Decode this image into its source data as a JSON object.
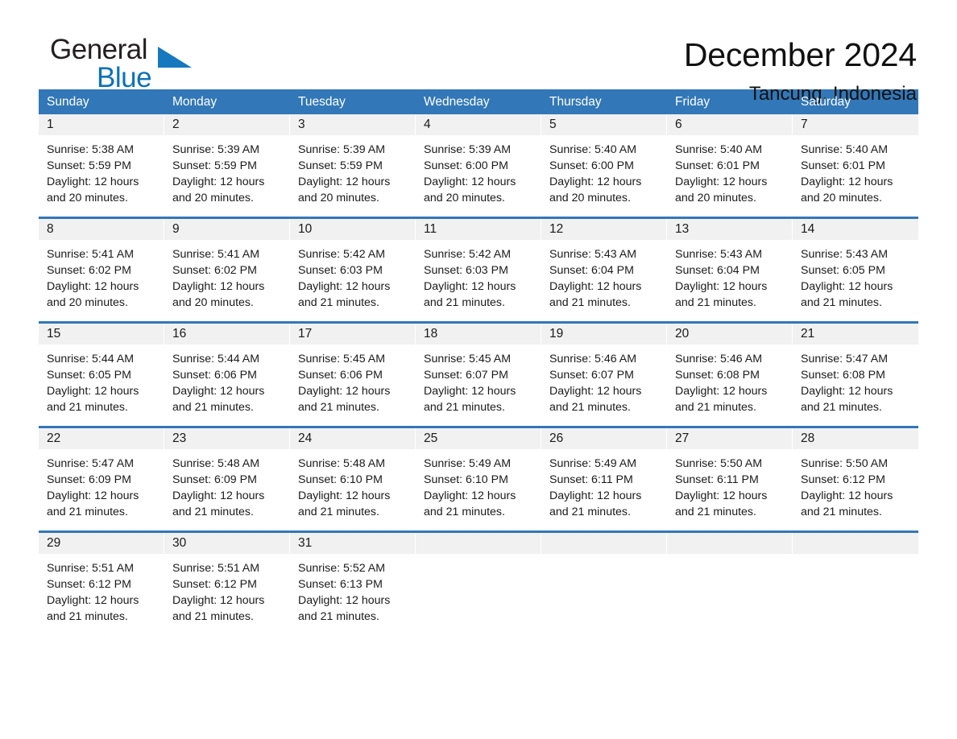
{
  "brand": {
    "name_part1": "General",
    "name_part2": "Blue",
    "triangle_color": "#1678be",
    "blue_color": "#0b72b9"
  },
  "header": {
    "title": "December 2024",
    "location": "Tancung, Indonesia"
  },
  "colors": {
    "header_blue": "#3277b7",
    "day_band": "#f1f1f1",
    "text": "#1a1a1a"
  },
  "calendar": {
    "weekday_headers": [
      "Sunday",
      "Monday",
      "Tuesday",
      "Wednesday",
      "Thursday",
      "Friday",
      "Saturday"
    ],
    "weeks": [
      [
        {
          "day": "1",
          "sunrise": "Sunrise: 5:38 AM",
          "sunset": "Sunset: 5:59 PM",
          "daylight_line1": "Daylight: 12 hours",
          "daylight_line2": "and 20 minutes."
        },
        {
          "day": "2",
          "sunrise": "Sunrise: 5:39 AM",
          "sunset": "Sunset: 5:59 PM",
          "daylight_line1": "Daylight: 12 hours",
          "daylight_line2": "and 20 minutes."
        },
        {
          "day": "3",
          "sunrise": "Sunrise: 5:39 AM",
          "sunset": "Sunset: 5:59 PM",
          "daylight_line1": "Daylight: 12 hours",
          "daylight_line2": "and 20 minutes."
        },
        {
          "day": "4",
          "sunrise": "Sunrise: 5:39 AM",
          "sunset": "Sunset: 6:00 PM",
          "daylight_line1": "Daylight: 12 hours",
          "daylight_line2": "and 20 minutes."
        },
        {
          "day": "5",
          "sunrise": "Sunrise: 5:40 AM",
          "sunset": "Sunset: 6:00 PM",
          "daylight_line1": "Daylight: 12 hours",
          "daylight_line2": "and 20 minutes."
        },
        {
          "day": "6",
          "sunrise": "Sunrise: 5:40 AM",
          "sunset": "Sunset: 6:01 PM",
          "daylight_line1": "Daylight: 12 hours",
          "daylight_line2": "and 20 minutes."
        },
        {
          "day": "7",
          "sunrise": "Sunrise: 5:40 AM",
          "sunset": "Sunset: 6:01 PM",
          "daylight_line1": "Daylight: 12 hours",
          "daylight_line2": "and 20 minutes."
        }
      ],
      [
        {
          "day": "8",
          "sunrise": "Sunrise: 5:41 AM",
          "sunset": "Sunset: 6:02 PM",
          "daylight_line1": "Daylight: 12 hours",
          "daylight_line2": "and 20 minutes."
        },
        {
          "day": "9",
          "sunrise": "Sunrise: 5:41 AM",
          "sunset": "Sunset: 6:02 PM",
          "daylight_line1": "Daylight: 12 hours",
          "daylight_line2": "and 20 minutes."
        },
        {
          "day": "10",
          "sunrise": "Sunrise: 5:42 AM",
          "sunset": "Sunset: 6:03 PM",
          "daylight_line1": "Daylight: 12 hours",
          "daylight_line2": "and 21 minutes."
        },
        {
          "day": "11",
          "sunrise": "Sunrise: 5:42 AM",
          "sunset": "Sunset: 6:03 PM",
          "daylight_line1": "Daylight: 12 hours",
          "daylight_line2": "and 21 minutes."
        },
        {
          "day": "12",
          "sunrise": "Sunrise: 5:43 AM",
          "sunset": "Sunset: 6:04 PM",
          "daylight_line1": "Daylight: 12 hours",
          "daylight_line2": "and 21 minutes."
        },
        {
          "day": "13",
          "sunrise": "Sunrise: 5:43 AM",
          "sunset": "Sunset: 6:04 PM",
          "daylight_line1": "Daylight: 12 hours",
          "daylight_line2": "and 21 minutes."
        },
        {
          "day": "14",
          "sunrise": "Sunrise: 5:43 AM",
          "sunset": "Sunset: 6:05 PM",
          "daylight_line1": "Daylight: 12 hours",
          "daylight_line2": "and 21 minutes."
        }
      ],
      [
        {
          "day": "15",
          "sunrise": "Sunrise: 5:44 AM",
          "sunset": "Sunset: 6:05 PM",
          "daylight_line1": "Daylight: 12 hours",
          "daylight_line2": "and 21 minutes."
        },
        {
          "day": "16",
          "sunrise": "Sunrise: 5:44 AM",
          "sunset": "Sunset: 6:06 PM",
          "daylight_line1": "Daylight: 12 hours",
          "daylight_line2": "and 21 minutes."
        },
        {
          "day": "17",
          "sunrise": "Sunrise: 5:45 AM",
          "sunset": "Sunset: 6:06 PM",
          "daylight_line1": "Daylight: 12 hours",
          "daylight_line2": "and 21 minutes."
        },
        {
          "day": "18",
          "sunrise": "Sunrise: 5:45 AM",
          "sunset": "Sunset: 6:07 PM",
          "daylight_line1": "Daylight: 12 hours",
          "daylight_line2": "and 21 minutes."
        },
        {
          "day": "19",
          "sunrise": "Sunrise: 5:46 AM",
          "sunset": "Sunset: 6:07 PM",
          "daylight_line1": "Daylight: 12 hours",
          "daylight_line2": "and 21 minutes."
        },
        {
          "day": "20",
          "sunrise": "Sunrise: 5:46 AM",
          "sunset": "Sunset: 6:08 PM",
          "daylight_line1": "Daylight: 12 hours",
          "daylight_line2": "and 21 minutes."
        },
        {
          "day": "21",
          "sunrise": "Sunrise: 5:47 AM",
          "sunset": "Sunset: 6:08 PM",
          "daylight_line1": "Daylight: 12 hours",
          "daylight_line2": "and 21 minutes."
        }
      ],
      [
        {
          "day": "22",
          "sunrise": "Sunrise: 5:47 AM",
          "sunset": "Sunset: 6:09 PM",
          "daylight_line1": "Daylight: 12 hours",
          "daylight_line2": "and 21 minutes."
        },
        {
          "day": "23",
          "sunrise": "Sunrise: 5:48 AM",
          "sunset": "Sunset: 6:09 PM",
          "daylight_line1": "Daylight: 12 hours",
          "daylight_line2": "and 21 minutes."
        },
        {
          "day": "24",
          "sunrise": "Sunrise: 5:48 AM",
          "sunset": "Sunset: 6:10 PM",
          "daylight_line1": "Daylight: 12 hours",
          "daylight_line2": "and 21 minutes."
        },
        {
          "day": "25",
          "sunrise": "Sunrise: 5:49 AM",
          "sunset": "Sunset: 6:10 PM",
          "daylight_line1": "Daylight: 12 hours",
          "daylight_line2": "and 21 minutes."
        },
        {
          "day": "26",
          "sunrise": "Sunrise: 5:49 AM",
          "sunset": "Sunset: 6:11 PM",
          "daylight_line1": "Daylight: 12 hours",
          "daylight_line2": "and 21 minutes."
        },
        {
          "day": "27",
          "sunrise": "Sunrise: 5:50 AM",
          "sunset": "Sunset: 6:11 PM",
          "daylight_line1": "Daylight: 12 hours",
          "daylight_line2": "and 21 minutes."
        },
        {
          "day": "28",
          "sunrise": "Sunrise: 5:50 AM",
          "sunset": "Sunset: 6:12 PM",
          "daylight_line1": "Daylight: 12 hours",
          "daylight_line2": "and 21 minutes."
        }
      ],
      [
        {
          "day": "29",
          "sunrise": "Sunrise: 5:51 AM",
          "sunset": "Sunset: 6:12 PM",
          "daylight_line1": "Daylight: 12 hours",
          "daylight_line2": "and 21 minutes."
        },
        {
          "day": "30",
          "sunrise": "Sunrise: 5:51 AM",
          "sunset": "Sunset: 6:12 PM",
          "daylight_line1": "Daylight: 12 hours",
          "daylight_line2": "and 21 minutes."
        },
        {
          "day": "31",
          "sunrise": "Sunrise: 5:52 AM",
          "sunset": "Sunset: 6:13 PM",
          "daylight_line1": "Daylight: 12 hours",
          "daylight_line2": "and 21 minutes."
        },
        {
          "day": "",
          "sunrise": "",
          "sunset": "",
          "daylight_line1": "",
          "daylight_line2": ""
        },
        {
          "day": "",
          "sunrise": "",
          "sunset": "",
          "daylight_line1": "",
          "daylight_line2": ""
        },
        {
          "day": "",
          "sunrise": "",
          "sunset": "",
          "daylight_line1": "",
          "daylight_line2": ""
        },
        {
          "day": "",
          "sunrise": "",
          "sunset": "",
          "daylight_line1": "",
          "daylight_line2": ""
        }
      ]
    ]
  }
}
